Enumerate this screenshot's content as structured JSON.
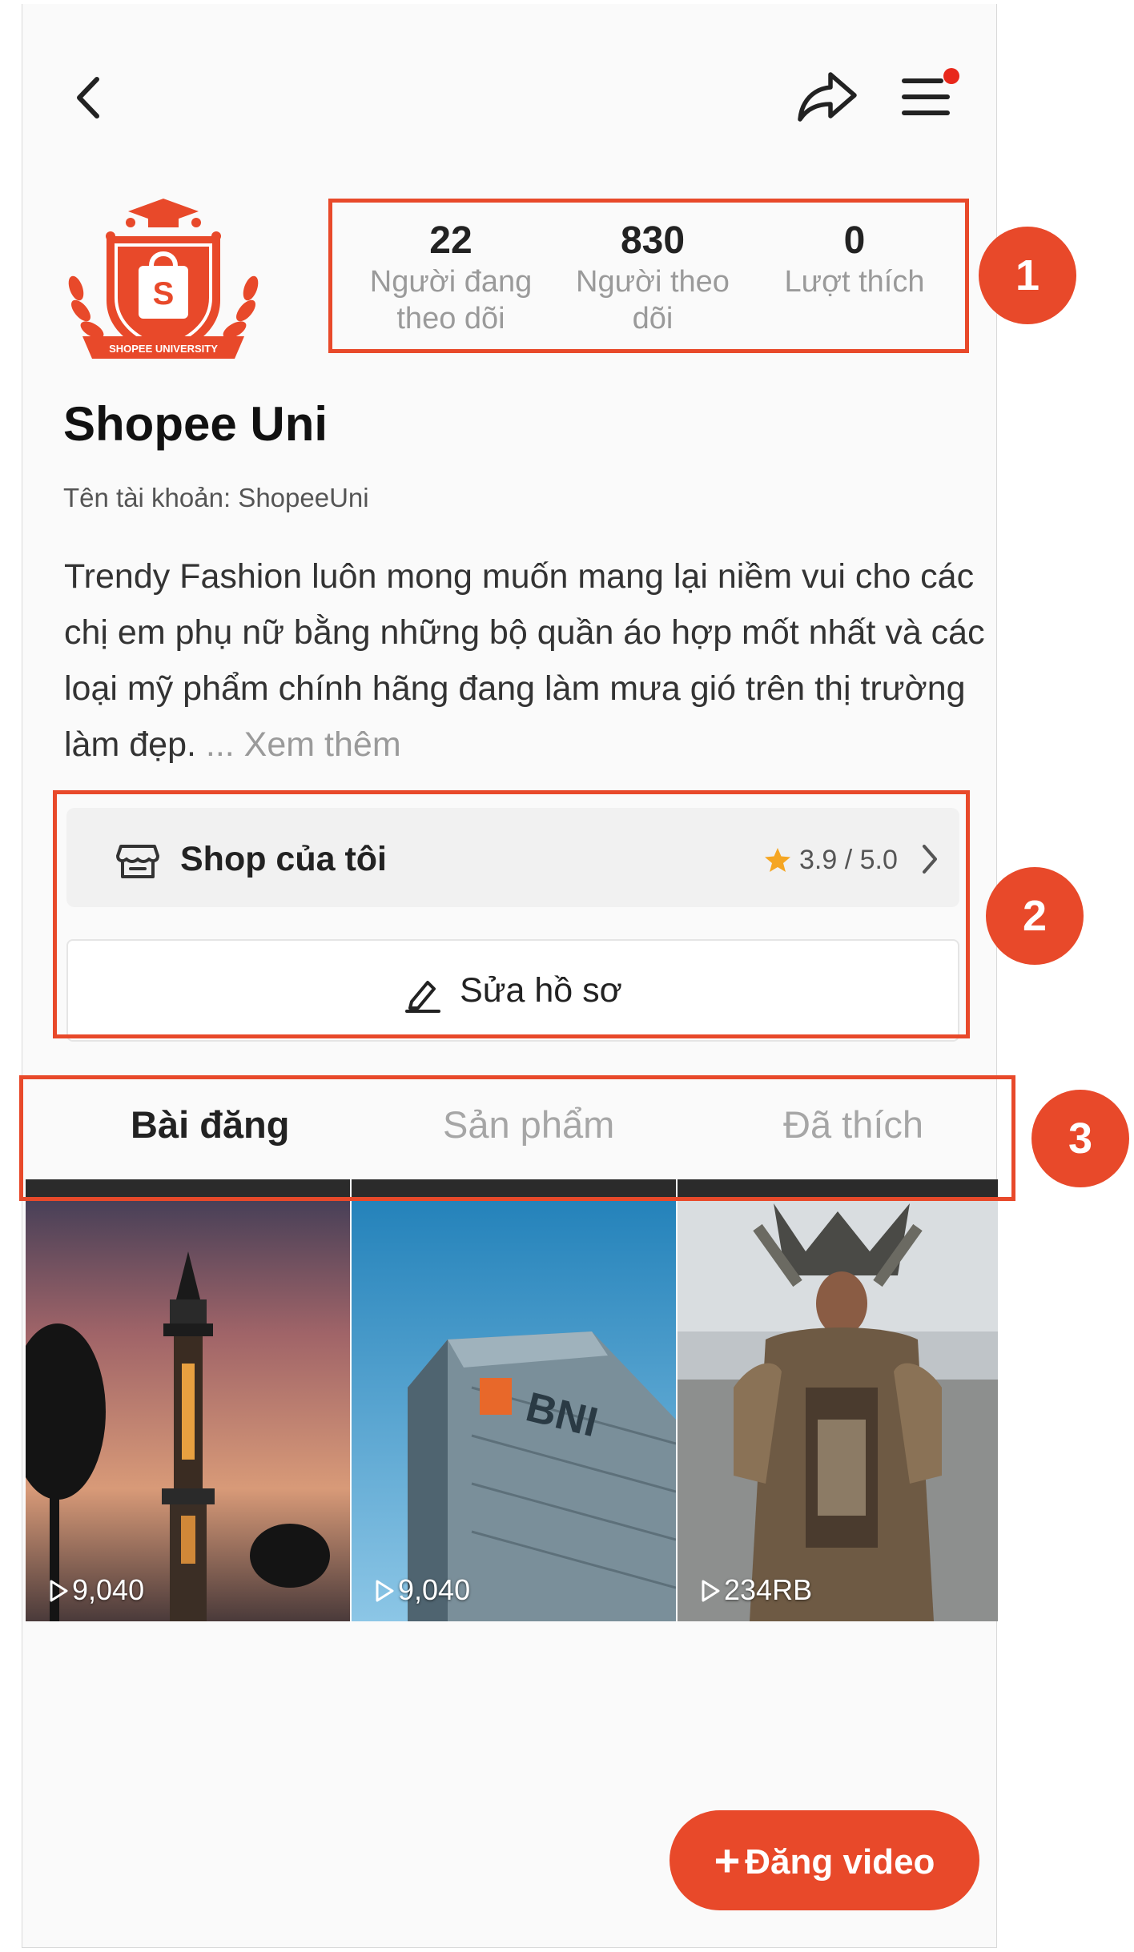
{
  "profile": {
    "name": "Shopee Uni",
    "username": "Tên tài khoản: ShopeeUni",
    "bio": "Trendy Fashion luôn mong muốn mang lại niềm vui cho các chị em phụ nữ bằng những bộ quần áo hợp mốt nhất và các loại mỹ phẩm chính hãng đang làm mưa gió trên thị trường làm đẹp.",
    "bio_more": "... Xem thêm",
    "logo_text": "SHOPEE UNIVERSITY"
  },
  "stats": [
    {
      "value": "22",
      "label_line1": "Người đang",
      "label_line2": "theo dõi"
    },
    {
      "value": "830",
      "label_line1": "Người theo",
      "label_line2": "dõi"
    },
    {
      "value": "0",
      "label_line1": "Lượt thích",
      "label_line2": ""
    }
  ],
  "shop": {
    "label": "Shop của tôi",
    "rating": "3.9 / 5.0"
  },
  "edit_profile": {
    "label": "Sửa hồ sơ"
  },
  "tabs": [
    {
      "label": "Bài đăng",
      "active": true
    },
    {
      "label": "Sản phẩm",
      "active": false
    },
    {
      "label": "Đã thích",
      "active": false
    }
  ],
  "videos": [
    {
      "views": "9,040",
      "scene": "tower-sunset"
    },
    {
      "views": "9,040",
      "scene": "bni-building"
    },
    {
      "views": "234RB",
      "scene": "costume-performer"
    }
  ],
  "fab": {
    "label": "Đăng video"
  },
  "markers": [
    "1",
    "2",
    "3"
  ],
  "icons": {
    "back": "chevron-left-icon",
    "share": "share-icon",
    "menu": "hamburger-menu-icon",
    "shop": "store-icon",
    "star": "star-icon",
    "edit": "pencil-icon",
    "play": "play-icon"
  },
  "colors": {
    "accent": "#e8492a",
    "notification_dot": "#e8281b",
    "star": "#f5a623"
  }
}
